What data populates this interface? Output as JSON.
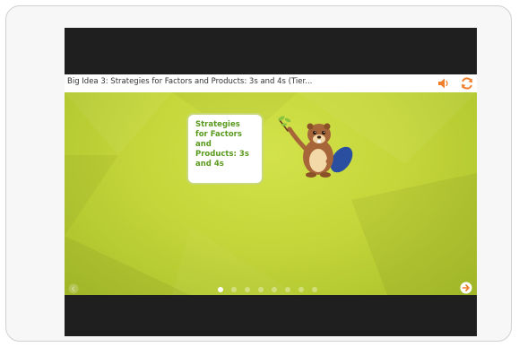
{
  "lesson": {
    "title": "Big Idea 3: Strategies for Factors and Products: 3s and 4s (Tier..."
  },
  "slide": {
    "card_text": "Strategies for Factors and Products: 3s and 4s",
    "pagination": {
      "total": 8,
      "current": 1
    }
  },
  "icons": {
    "sound": "speaker-icon",
    "refresh": "refresh-icon",
    "previous": "arrow-left-icon",
    "next": "arrow-right-icon",
    "mascot": "beaver-mascot"
  },
  "colors": {
    "accent": "#f07d2a",
    "slide_background": "#c4d63a",
    "card_text": "#5a9a1e"
  }
}
